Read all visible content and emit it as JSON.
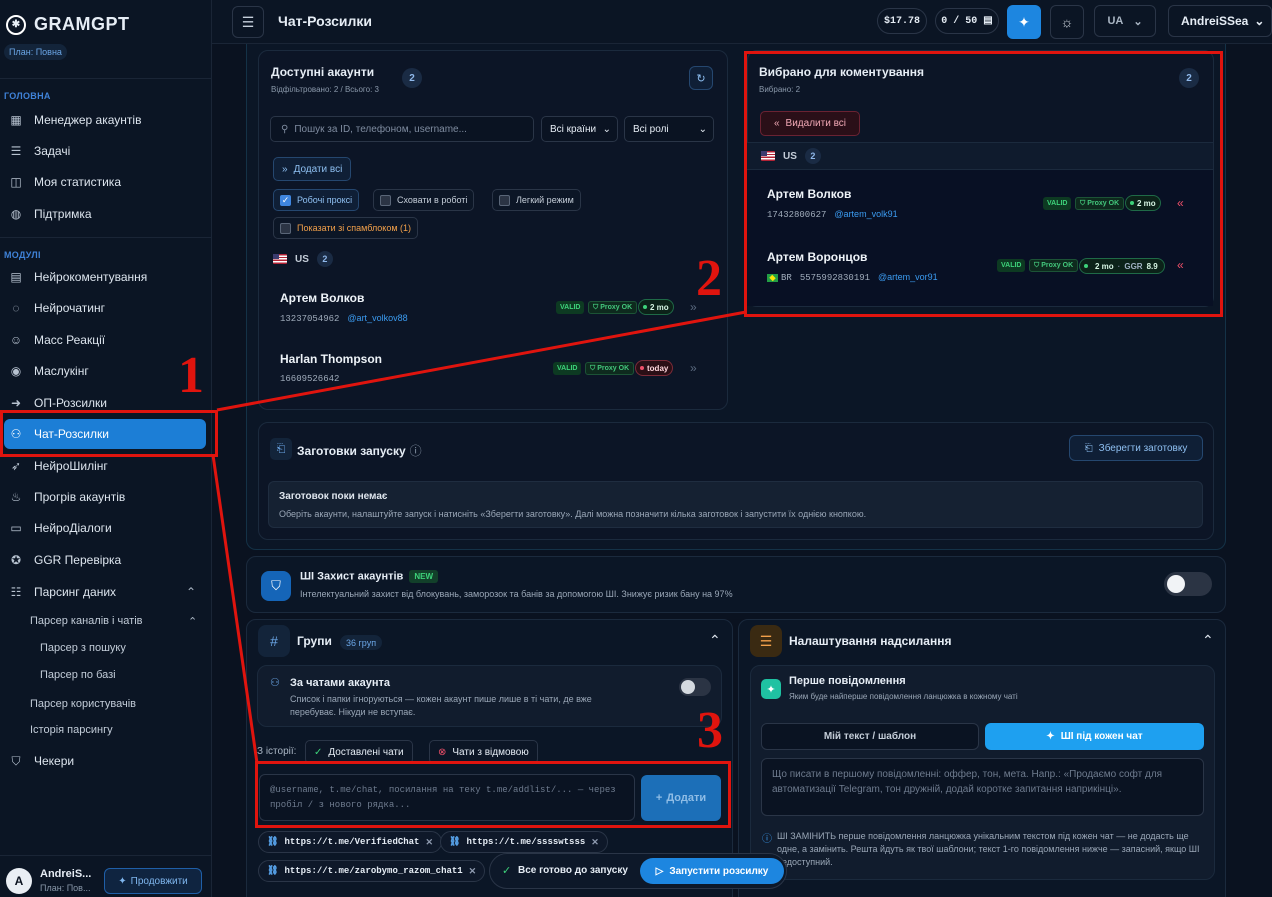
{
  "app": {
    "name": "GRAMGPT",
    "plan": "План: Повна"
  },
  "sidebar": {
    "section_main": "ГОЛОВНА",
    "main_items": [
      {
        "label": "Менеджер акаунтів",
        "icon": "grid-icon"
      },
      {
        "label": "Задачі",
        "icon": "list-icon"
      },
      {
        "label": "Моя статистика",
        "icon": "chart-icon"
      },
      {
        "label": "Підтримка",
        "icon": "globe-icon"
      }
    ],
    "section_modules": "МОДУЛІ",
    "module_items": [
      {
        "label": "Нейрокоментування",
        "icon": "comment-icon"
      },
      {
        "label": "Нейрочатинг",
        "icon": "chat-bubble-icon"
      },
      {
        "label": "Масс Реакції",
        "icon": "smile-icon"
      },
      {
        "label": "Маслукінг",
        "icon": "eye-icon"
      },
      {
        "label": "ОП-Розсилки",
        "icon": "send-icon"
      },
      {
        "label": "Чат-Розсилки",
        "icon": "users-icon",
        "active": true
      },
      {
        "label": "НейроШилінг",
        "icon": "rocket-icon"
      },
      {
        "label": "Прогрів акаунтів",
        "icon": "flame-icon"
      },
      {
        "label": "НейроДіалоги",
        "icon": "dialog-icon"
      },
      {
        "label": "GGR Перевірка",
        "icon": "star-icon"
      },
      {
        "label": "Парсинг даних",
        "icon": "database-icon"
      }
    ],
    "parsing_sub": {
      "channels": "Парсер каналів і чатів",
      "search": "Парсер з пошуку",
      "base": "Парсер по базі",
      "users": "Парсер користувачів",
      "history": "Історія парсингу"
    },
    "checkers": "Чекери",
    "user": {
      "initial": "A",
      "name": "AndreiS...",
      "plan": "План: Пов...",
      "upgrade": "Продовжити"
    }
  },
  "topbar": {
    "title": "Чат-Розсилки",
    "balance": "$17.78",
    "quota": "0 / 50 ▤",
    "lang": "UA",
    "user": "AndreiSSea"
  },
  "available": {
    "title": "Доступні акаунти",
    "subtitle": "Відфільтровано: 2 / Всього: 3",
    "count": "2",
    "search_placeholder": "Пошук за ID, телефоном, username...",
    "country_select": "Всі країни",
    "role_select": "Всі ролі",
    "add_all": "Додати всі",
    "filters": {
      "working_proxy": "Робочі проксі",
      "hide_working": "Сховати в роботі",
      "light_mode": "Легкий режим",
      "spamblock": "Показати зі спамблоком (1)"
    },
    "group": {
      "country": "US",
      "count": "2"
    },
    "accounts": [
      {
        "name": "Артем Волков",
        "id": "13237054962",
        "username": "@art_volkov88",
        "valid": "VALID",
        "proxy": "Proxy OK",
        "age": "2 mo"
      },
      {
        "name": "Harlan Thompson",
        "id": "16609526642",
        "username": "",
        "valid": "VALID",
        "proxy": "Proxy OK",
        "age": "today"
      }
    ]
  },
  "selected": {
    "title": "Вибрано для коментування",
    "subtitle": "Вибрано: 2",
    "count": "2",
    "remove_all": "Видалити всі",
    "group": {
      "country": "US",
      "count": "2"
    },
    "accounts": [
      {
        "name": "Артем Волков",
        "id": "17432800627",
        "username": "@artem_volk91",
        "valid": "VALID",
        "proxy": "Proxy OK",
        "age": "2 mo"
      },
      {
        "name": "Артем Воронцов",
        "country": "BR",
        "id": "5575992830191",
        "username": "@artem_vor91",
        "valid": "VALID",
        "proxy": "Proxy OK",
        "age": "2 mo",
        "ggr": "GGR",
        "ggr_value": "8.9"
      }
    ]
  },
  "presets": {
    "title": "Заготовки запуску",
    "save": "Зберегти заготовку",
    "empty_title": "Заготовок поки немає",
    "empty_text": "Оберіть акаунти, налаштуйте запуск і натисніть «Зберегти заготовку». Далі можна позначити кілька заготовок і запустити їх однією кнопкою."
  },
  "ai_protect": {
    "title": "ШІ Захист акаунтів",
    "badge": "NEW",
    "text": "Інтелектуальний захист від блокувань, заморозок та банів за допомогою ШІ. Знижує ризик бану на 97%"
  },
  "groups": {
    "title": "Групи",
    "count": "36 груп",
    "by_account_title": "За чатами акаунта",
    "by_account_text": "Список і папки ігноруються — кожен акаунт пише лише в ті чати, де вже перебуває. Нікуди не вступає.",
    "history_label": "З історії:",
    "delivered": "Доставлені чати",
    "rejected": "Чати з відмовою",
    "input_placeholder": "@username, t.me/chat, посилання на теку t.me/addlist/... — через пробіл / з нового рядка...",
    "add": "Додати",
    "chips": [
      "https://t.me/VerifiedChat",
      "https://t.me/sssswtsss",
      "https://t.me/zarobymo_razom_chat1"
    ]
  },
  "send_settings": {
    "title": "Налаштування надсилання",
    "first_title": "Перше повідомлення",
    "first_sub": "Яким буде найперше повідомлення ланцюжка в кожному чаті",
    "tab_own": "Мій текст / шаблон",
    "tab_ai": "ШІ під кожен чат",
    "prompt_placeholder": "Що писати в першому повідомленні: оффер, тон, мета. Напр.: «Продаємо софт для автоматизації Telegram, тон дружній, додай коротке запитання наприкінці».",
    "note": "ШІ ЗАМІНИТЬ перше повідомлення ланцюжка унікальним текстом під кожен чат — не додасть ще одне, а замінить. Решта йдуть як твої шаблони; текст 1-го повідомлення нижче — запасний, якщо ШІ недоступний."
  },
  "launch": {
    "status": "Все готово до запуску",
    "button": "Запустити розсилку"
  },
  "annotations": {
    "one": "1",
    "two": "2",
    "three": "3"
  },
  "colors": {
    "accent": "#1c7ed6",
    "annotation": "#e0140e",
    "valid": "#3dd27a",
    "danger": "#f0506a"
  }
}
